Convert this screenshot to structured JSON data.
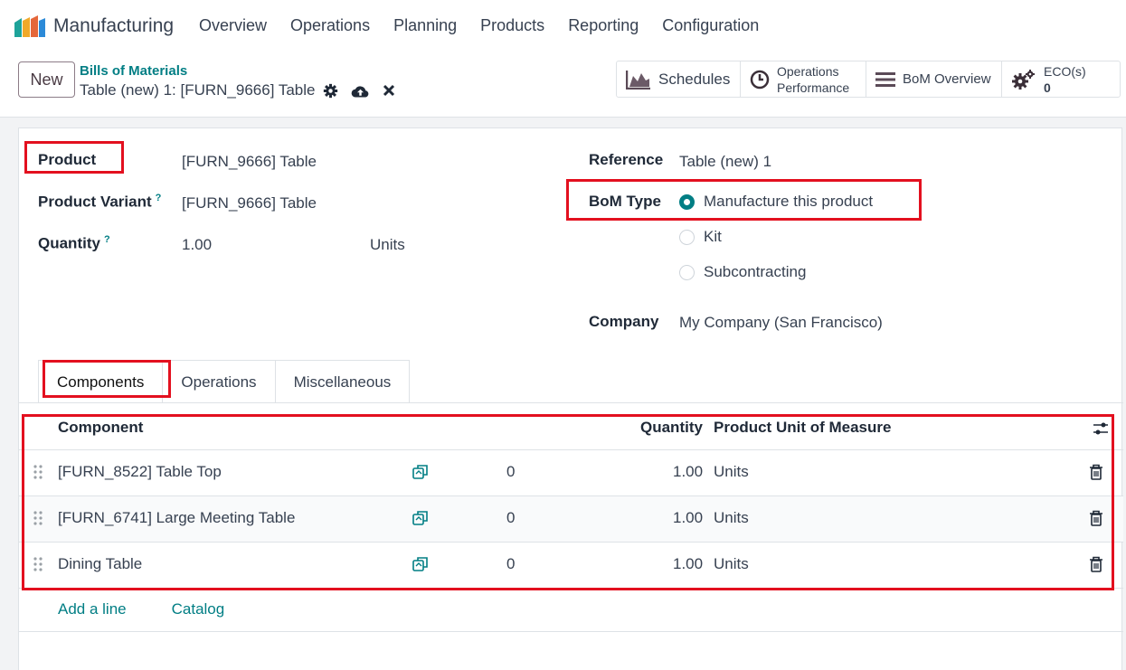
{
  "navbar": {
    "app_name": "Manufacturing",
    "menu": [
      "Overview",
      "Operations",
      "Planning",
      "Products",
      "Reporting",
      "Configuration"
    ]
  },
  "control": {
    "new_label": "New",
    "breadcrumb": "Bills of Materials",
    "record_title": "Table (new) 1: [FURN_9666] Table",
    "smart_buttons": {
      "schedules": "Schedules",
      "ops_perf_1": "Operations",
      "ops_perf_2": "Performance",
      "bom_overview": "BoM Overview",
      "eco_label": "ECO(s)",
      "eco_count": "0"
    }
  },
  "form": {
    "product_label": "Product",
    "product_value": "[FURN_9666] Table",
    "variant_label": "Product Variant",
    "variant_value": "[FURN_9666] Table",
    "quantity_label": "Quantity",
    "quantity_value": "1.00",
    "quantity_uom": "Units",
    "help_mark": "?",
    "reference_label": "Reference",
    "reference_value": "Table (new) 1",
    "bom_type_label": "BoM Type",
    "bom_types": [
      "Manufacture this product",
      "Kit",
      "Subcontracting"
    ],
    "bom_type_selected": "Manufacture this product",
    "company_label": "Company",
    "company_value": "My Company (San Francisco)"
  },
  "tabs": [
    "Components",
    "Operations",
    "Miscellaneous"
  ],
  "table": {
    "headers": {
      "component": "Component",
      "quantity": "Quantity",
      "uom": "Product Unit of Measure"
    },
    "rows": [
      {
        "component": "[FURN_8522] Table Top",
        "count": "0",
        "quantity": "1.00",
        "uom": "Units"
      },
      {
        "component": "[FURN_6741] Large Meeting Table",
        "count": "0",
        "quantity": "1.00",
        "uom": "Units"
      },
      {
        "component": "Dining Table",
        "count": "0",
        "quantity": "1.00",
        "uom": "Units"
      }
    ]
  },
  "footer_links": {
    "add_line": "Add a line",
    "catalog": "Catalog"
  },
  "colors": {
    "accent": "#017e84",
    "highlight": "#e3101f"
  }
}
